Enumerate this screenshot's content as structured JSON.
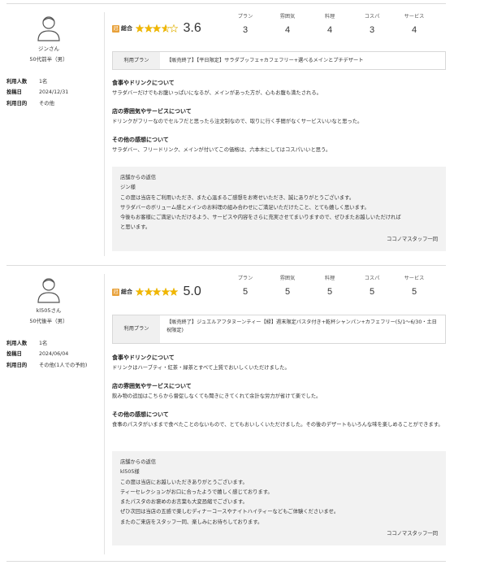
{
  "reviews": [
    {
      "user_name": "ジンさん",
      "user_age": "50代前半（男）",
      "meta": [
        {
          "key": "利用人数",
          "value": "1名"
        },
        {
          "key": "投稿日",
          "value": "2024/12/31"
        },
        {
          "key": "利用日的",
          "value": "その他"
        }
      ],
      "overall_label": "総合",
      "rating": 3.6,
      "rating_text": "3.6",
      "categories": [
        {
          "label": "プラン",
          "value": "3"
        },
        {
          "label": "雰囲気",
          "value": "4"
        },
        {
          "label": "料理",
          "value": "4"
        },
        {
          "label": "コスパ",
          "value": "3"
        },
        {
          "label": "サービス",
          "value": "4"
        }
      ],
      "plan_label": "利用プラン",
      "plan_text": "【販売終了】【平日限定】サラダブッフェ+カフェフリー+選べるメインとプチデザート",
      "sections": [
        {
          "title": "食事やドリンクについて",
          "body": "サラダバーだけでもお腹いっぱいになるが、メインがあった方が、心もお腹も満たされる。"
        },
        {
          "title": "店の雰囲気やサービスについて",
          "body": "ドリンクがフリーなのでセルフだと思ったら注文制なので、取りに行く手間がなくサービスいいなと思った。"
        },
        {
          "title": "その他の感想について",
          "body": "サラダバー、フリードリンク、メインが付いてこの価格は、六本木にしてはコスパいいと思う。"
        }
      ],
      "reply": {
        "title": "店舗からの返信",
        "lines": [
          "ジン様",
          "この度は当店をご利用いただき、また心温まるご感想をお寄せいただき、誠にありがとうございます。",
          "サラダバーのボリューム感とメインのお料理の組み合わせにご満足いただけたこと、とても嬉しく思います。",
          "今後もお客様にご満足いただけるよう、サービスや内容をさらに充実させてまいりますので、ぜひまたお越しいただければ",
          "と思います。"
        ],
        "sign": "ココノマスタッフ一同"
      }
    },
    {
      "user_name": "kl505さん",
      "user_age": "50代後半（男）",
      "meta": [
        {
          "key": "利用人数",
          "value": "1名"
        },
        {
          "key": "投稿日",
          "value": "2024/06/04"
        },
        {
          "key": "利用日的",
          "value": "その他(1人での予約)"
        }
      ],
      "overall_label": "総合",
      "rating": 5.0,
      "rating_text": "5.0",
      "categories": [
        {
          "label": "プラン",
          "value": "5"
        },
        {
          "label": "雰囲気",
          "value": "5"
        },
        {
          "label": "料理",
          "value": "5"
        },
        {
          "label": "コスパ",
          "value": "5"
        },
        {
          "label": "サービス",
          "value": "5"
        }
      ],
      "plan_label": "利用プラン",
      "plan_text": "【販売終了】ジュエルアフタヌーンティー【緑】週末限定パスタ付き+乾杯シャンパン+カフェフリー(5/1～6/30・土日祝限定)",
      "sections": [
        {
          "title": "食事やドリンクについて",
          "body": "ドリンクはハーブティ・紅茶・緑茶とすべて上質でおいしくいただけました。"
        },
        {
          "title": "店の雰囲気やサービスについて",
          "body": "飲み物の追加はこちらから督促しなくても聞きにきてくれて余計な労力が省けて楽でした。"
        },
        {
          "title": "その他の感想について",
          "body": "食事のパスタがいままで食べたことのないもので、とてもおいしくいただけました。その後のデザートもいろんな味を楽しめることができます。"
        }
      ],
      "reply": {
        "title": "店舗からの返信",
        "lines": [
          "kl505様",
          "この度は当店にお越しいただきありがとうございます。",
          "ティーセレクションがお口に合ったようで嬉しく感じております。",
          "またパスタのお褒めのお言葉も大変恐縮でございます。",
          "ぜひ次回は当店の五感で楽しむディナーコースやナイトハイティーなどもご体験くださいませ。",
          "またのご来店をスタッフ一同、楽しみにお待ちしております。"
        ],
        "sign": "ココノマスタッフ一同"
      }
    }
  ]
}
